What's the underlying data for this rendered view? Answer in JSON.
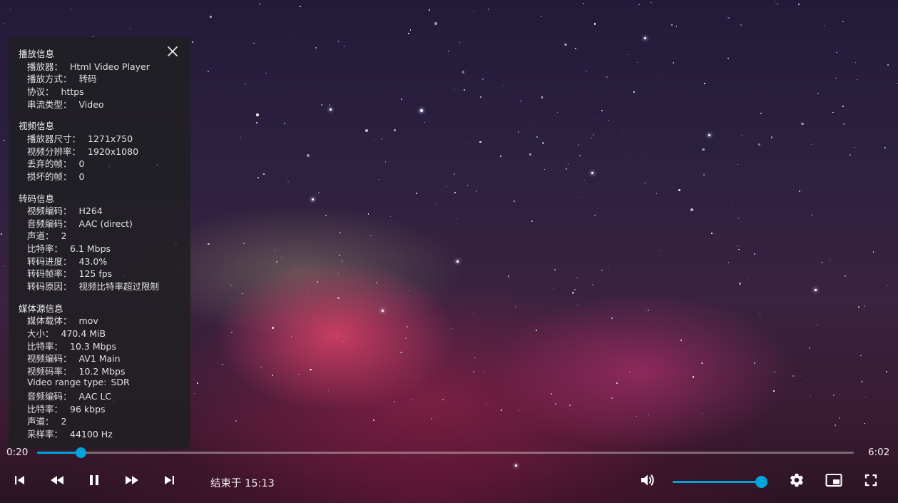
{
  "player": {
    "current_time": "0:20",
    "duration": "6:02",
    "progress_fraction": 0.053,
    "end_time_text": "结束于 15:13",
    "volume_fraction": 1.0,
    "accent_color": "#00a4dc"
  },
  "info_panel": {
    "close_icon": "close-icon",
    "sections": {
      "playback": {
        "title": "播放信息",
        "rows": [
          {
            "label": "播放器：",
            "value": "Html Video Player"
          },
          {
            "label": "播放方式：",
            "value": "转码"
          },
          {
            "label": "协议：",
            "value": "https"
          },
          {
            "label": "串流类型：",
            "value": "Video"
          }
        ]
      },
      "video": {
        "title": "视频信息",
        "rows": [
          {
            "label": "播放器尺寸：",
            "value": "1271x750"
          },
          {
            "label": "视频分辨率：",
            "value": "1920x1080"
          },
          {
            "label": "丢弃的帧：",
            "value": "0"
          },
          {
            "label": "损坏的帧：",
            "value": "0"
          }
        ]
      },
      "transcode": {
        "title": "转码信息",
        "rows": [
          {
            "label": "视频编码：",
            "value": "H264"
          },
          {
            "label": "音频编码：",
            "value": "AAC (direct)"
          },
          {
            "label": "声道：",
            "value": "2"
          },
          {
            "label": "比特率：",
            "value": "6.1 Mbps"
          },
          {
            "label": "转码进度：",
            "value": "43.0%"
          },
          {
            "label": "转码帧率：",
            "value": "125 fps"
          },
          {
            "label": "转码原因：",
            "value": "视频比特率超过限制"
          }
        ]
      },
      "source": {
        "title": "媒体源信息",
        "rows": [
          {
            "label": "媒体载体：",
            "value": "mov"
          },
          {
            "label": "大小：",
            "value": "470.4 MiB"
          },
          {
            "label": "比特率：",
            "value": "10.3 Mbps"
          },
          {
            "label": "视频编码：",
            "value": "AV1 Main"
          },
          {
            "label": "视频码率：",
            "value": "10.2 Mbps"
          },
          {
            "label": "Video range type:",
            "value": "SDR"
          },
          {
            "label": "音频编码：",
            "value": "AAC LC"
          },
          {
            "label": "比特率：",
            "value": "96 kbps"
          },
          {
            "label": "声道：",
            "value": "2"
          },
          {
            "label": "采样率：",
            "value": "44100 Hz"
          }
        ]
      }
    }
  },
  "controls": {
    "previous_icon": "skip-previous-icon",
    "rewind_icon": "rewind-icon",
    "pause_icon": "pause-icon",
    "forward_icon": "fast-forward-icon",
    "next_icon": "skip-next-icon",
    "volume_icon": "volume-icon",
    "settings_icon": "gear-icon",
    "pip_icon": "picture-in-picture-icon",
    "fullscreen_icon": "fullscreen-icon"
  }
}
